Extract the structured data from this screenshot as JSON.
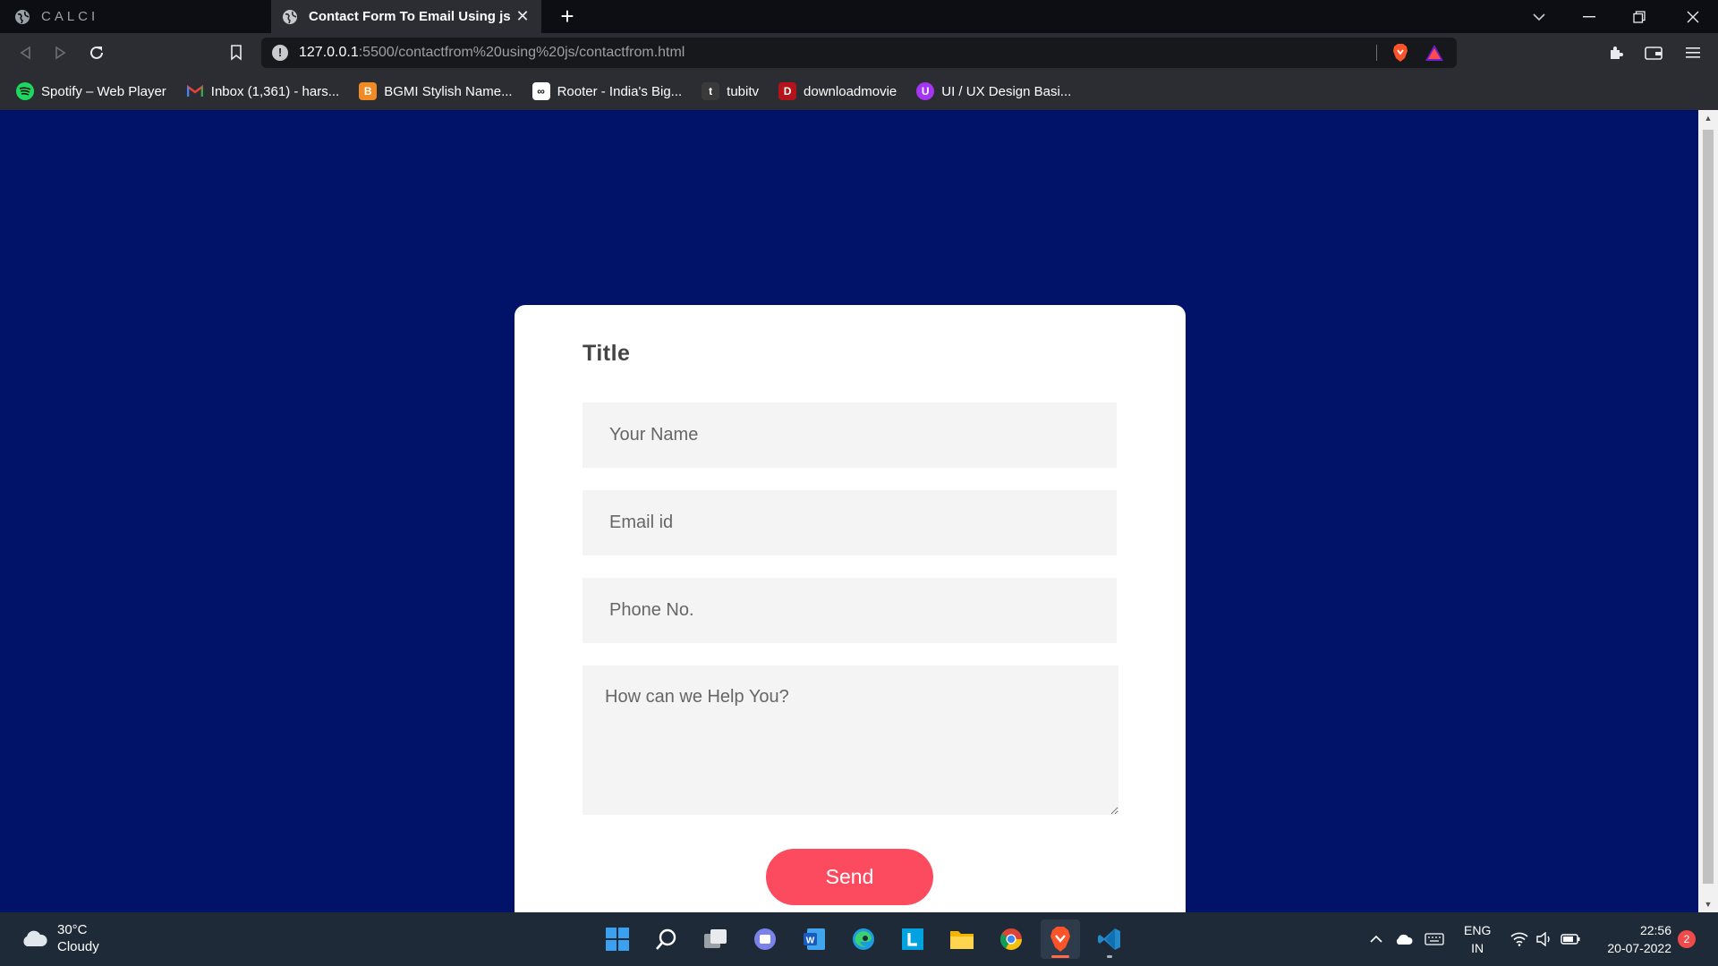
{
  "tabs": {
    "inactive_title": "CALCI",
    "active_title": "Contact Form To Email Using js"
  },
  "toolbar": {
    "url_host": "127.0.0.1",
    "url_rest": ":5500/contactfrom%20using%20js/contactfrom.html"
  },
  "bookmarks": [
    {
      "label": "Spotify – Web Player",
      "icon": "spotify-icon",
      "color": "#1ed760"
    },
    {
      "label": "Inbox (1,361) - hars...",
      "icon": "gmail-icon",
      "color": "#ea4335"
    },
    {
      "label": "BGMI Stylish Name...",
      "icon": "bgmi-icon",
      "color": "#f08a24"
    },
    {
      "label": "Rooter - India's Big...",
      "icon": "rooter-icon",
      "color": "#ffffff"
    },
    {
      "label": "tubitv",
      "icon": "tubitv-icon",
      "color": "#333333"
    },
    {
      "label": "downloadmovie",
      "icon": "downloadmovie-icon",
      "color": "#b3131b"
    },
    {
      "label": "UI / UX Design Basi...",
      "icon": "udemy-icon",
      "color": "#a435f0"
    }
  ],
  "form": {
    "title": "Title",
    "name_placeholder": "Your Name",
    "email_placeholder": "Email id",
    "phone_placeholder": "Phone No.",
    "message_placeholder": "How can we Help You?",
    "send_label": "Send",
    "page_bg": "#011368",
    "button_color": "#fc4a5f"
  },
  "taskbar": {
    "temperature": "30°C",
    "condition": "Cloudy",
    "lang_top": "ENG",
    "lang_bottom": "IN",
    "time": "22:56",
    "date": "20-07-2022",
    "notification_count": "2"
  }
}
